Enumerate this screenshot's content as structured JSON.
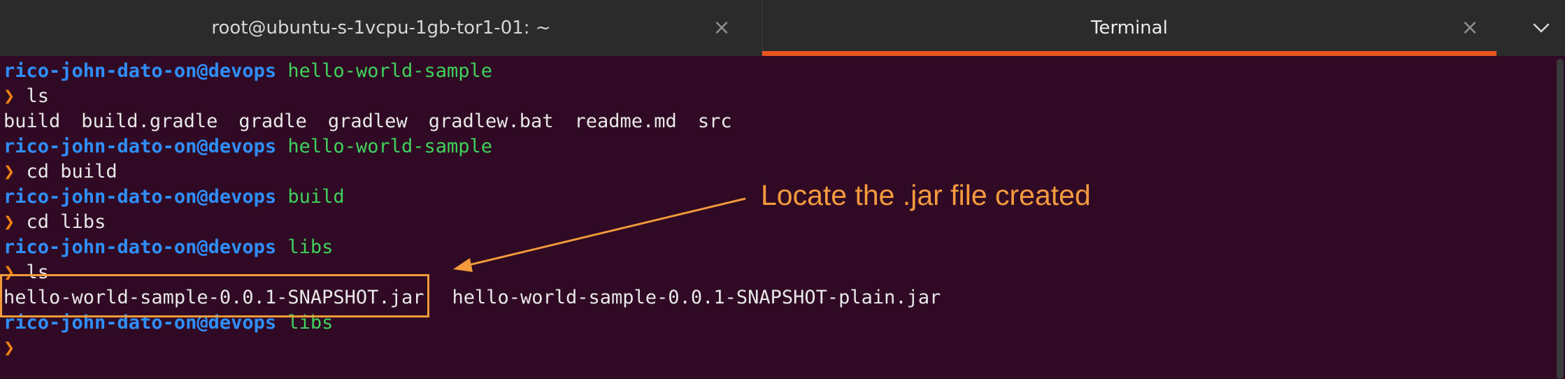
{
  "tabs": [
    {
      "title": "root@ubuntu-s-1vcpu-1gb-tor1-01: ~",
      "close": "×"
    },
    {
      "title": "Terminal",
      "close": "×"
    }
  ],
  "terminal": {
    "user": "rico-john-dato-on@devops",
    "prompt_symbol": "❯",
    "lines": [
      {
        "dir": "hello-world-sample"
      },
      {
        "cmd": "ls"
      },
      {
        "files": [
          "build",
          "build.gradle",
          "gradle",
          "gradlew",
          "gradlew.bat",
          "readme.md",
          "src"
        ]
      },
      {
        "dir": "hello-world-sample"
      },
      {
        "cmd": "cd build"
      },
      {
        "dir": "build"
      },
      {
        "cmd": "cd libs"
      },
      {
        "dir": "libs"
      },
      {
        "cmd": "ls"
      },
      {
        "files": [
          "hello-world-sample-0.0.1-SNAPSHOT.jar",
          "hello-world-sample-0.0.1-SNAPSHOT-plain.jar"
        ]
      },
      {
        "dir": "libs"
      },
      {
        "cmd": ""
      }
    ]
  },
  "annotation": {
    "text": "Locate the .jar file created",
    "color": "#f59a3f"
  },
  "colors": {
    "background": "#300a24",
    "tabbar": "#2b2b2b",
    "active_tab_indicator": "#e95420",
    "user": "#2f8ffa",
    "dir": "#3fd25c",
    "prompt": "#f27f13"
  }
}
